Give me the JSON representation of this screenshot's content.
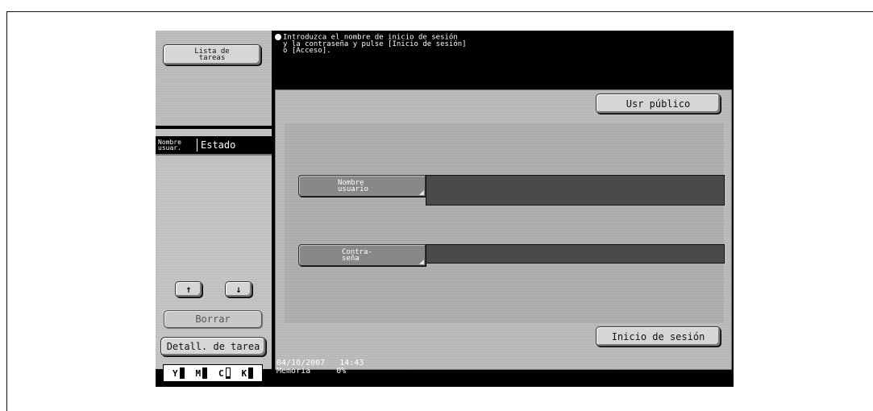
{
  "left_panel": {
    "job_list_button": "Lista de tareas",
    "column_user": "Nombre usuar.",
    "column_status": "Estado",
    "up_arrow": "↑",
    "down_arrow": "↓",
    "delete_button": "Borrar",
    "job_detail_button": "Detall. de tarea"
  },
  "toner": [
    {
      "label": "Y",
      "level": 1.0
    },
    {
      "label": "M",
      "level": 1.0
    },
    {
      "label": "C",
      "level": 0.15
    },
    {
      "label": "K",
      "level": 1.0
    }
  ],
  "message": {
    "line1": "Introduzca el nombre de inicio de sesión",
    "line2": "y la contraseña y pulse [Inicio de sesión]",
    "line3": "o [Acceso]."
  },
  "main": {
    "public_user_button": "Usr público",
    "username_label": "Nombre usuario",
    "password_label": "Contra- seña",
    "username_value": "",
    "password_value": "",
    "login_button": "Inicio de sesión"
  },
  "status_bar": {
    "date": "04/10/2007",
    "time": "14:43",
    "memory_label": "Memoria",
    "memory_value": "0%"
  }
}
